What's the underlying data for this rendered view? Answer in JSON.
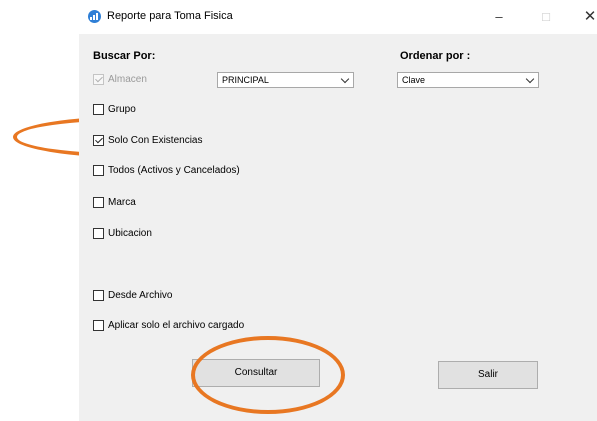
{
  "window": {
    "title": "Reporte para Toma Fisica",
    "minimize_glyph": "–",
    "maximize_glyph": "□",
    "close_glyph": "✕"
  },
  "search_section": {
    "label": "Buscar Por:"
  },
  "order_section": {
    "label": "Ordenar por :"
  },
  "checkboxes": {
    "almacen": {
      "label": "Almacen",
      "checked": true,
      "disabled": true
    },
    "grupo": {
      "label": "Grupo",
      "checked": false
    },
    "solo_existencias": {
      "label": "Solo Con Existencias",
      "checked": true
    },
    "todos": {
      "label": "Todos (Activos y Cancelados)",
      "checked": false
    },
    "marca": {
      "label": "Marca",
      "checked": false
    },
    "ubicacion": {
      "label": "Ubicacion",
      "checked": false
    },
    "desde_archivo": {
      "label": "Desde Archivo",
      "checked": false
    },
    "aplicar_archivo": {
      "label": "Aplicar solo el archivo cargado",
      "checked": false
    }
  },
  "almacen_select": {
    "value": "PRINCIPAL"
  },
  "order_select": {
    "value": "Clave"
  },
  "buttons": {
    "consultar": "Consultar",
    "salir": "Salir"
  },
  "colors": {
    "annotation": "#e87722",
    "window_bg": "#f0f0f0",
    "button_bg": "#e1e1e1"
  }
}
